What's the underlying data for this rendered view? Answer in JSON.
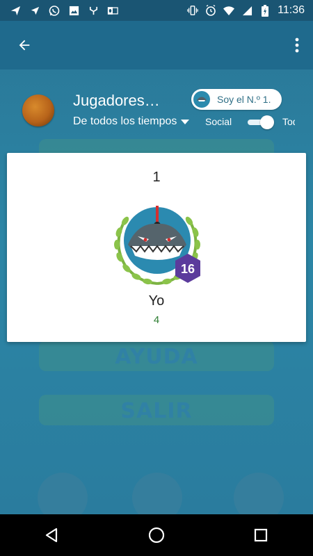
{
  "status_bar": {
    "time": "11:36",
    "left_icons": [
      "send-icon",
      "navigation-icon",
      "whatsapp-icon",
      "image-icon",
      "sync-icon",
      "outlook-icon"
    ],
    "right_icons": [
      "vibrate-icon",
      "alarm-icon",
      "wifi-icon",
      "signal-icon",
      "battery-charging-icon"
    ]
  },
  "background": {
    "band1_text": "",
    "ayuda_text": "AYUDA",
    "salir_text": "SALIR"
  },
  "header": {
    "title": "Jugadores…",
    "time_filter": "De todos los tiempos",
    "social_label": "Social",
    "all_label": "Todos",
    "rank_chip": "Soy el N.º 1."
  },
  "leaderboard": {
    "entry": {
      "rank": "1",
      "name": "Yo",
      "score": "4",
      "level": "16"
    }
  },
  "colors": {
    "app_bar": "#1f6a8d",
    "accent_score": "#2e7d32",
    "level_badge": "#5b3b9c",
    "wreath": "#8bc34a"
  }
}
